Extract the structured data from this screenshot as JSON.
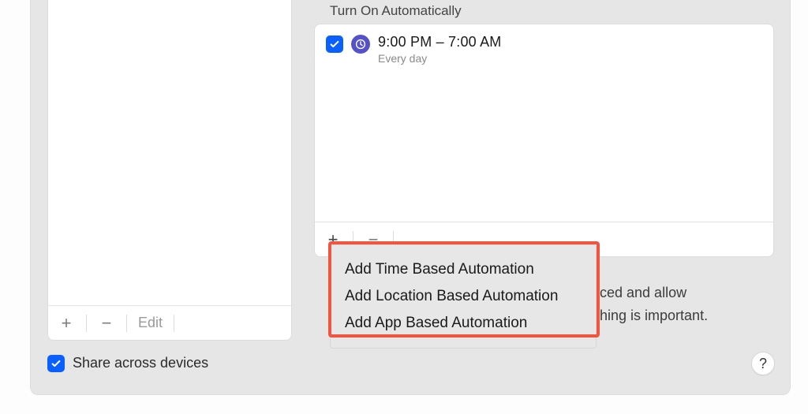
{
  "left": {
    "add_label": "+",
    "remove_label": "−",
    "edit_label": "Edit"
  },
  "right": {
    "section_title": "Turn On Automatically",
    "schedule": {
      "time_range": "9:00 PM – 7:00 AM",
      "frequency": "Every day"
    },
    "toolbar": {
      "add_label": "+",
      "remove_label": "−"
    },
    "description": {
      "line1_fragment": "ced and allow",
      "line2_fragment": "hing is important."
    }
  },
  "popup": {
    "items": [
      "Add Time Based Automation",
      "Add Location Based Automation",
      "Add App Based Automation"
    ]
  },
  "footer": {
    "share_label": "Share across devices"
  },
  "help": {
    "label": "?"
  }
}
